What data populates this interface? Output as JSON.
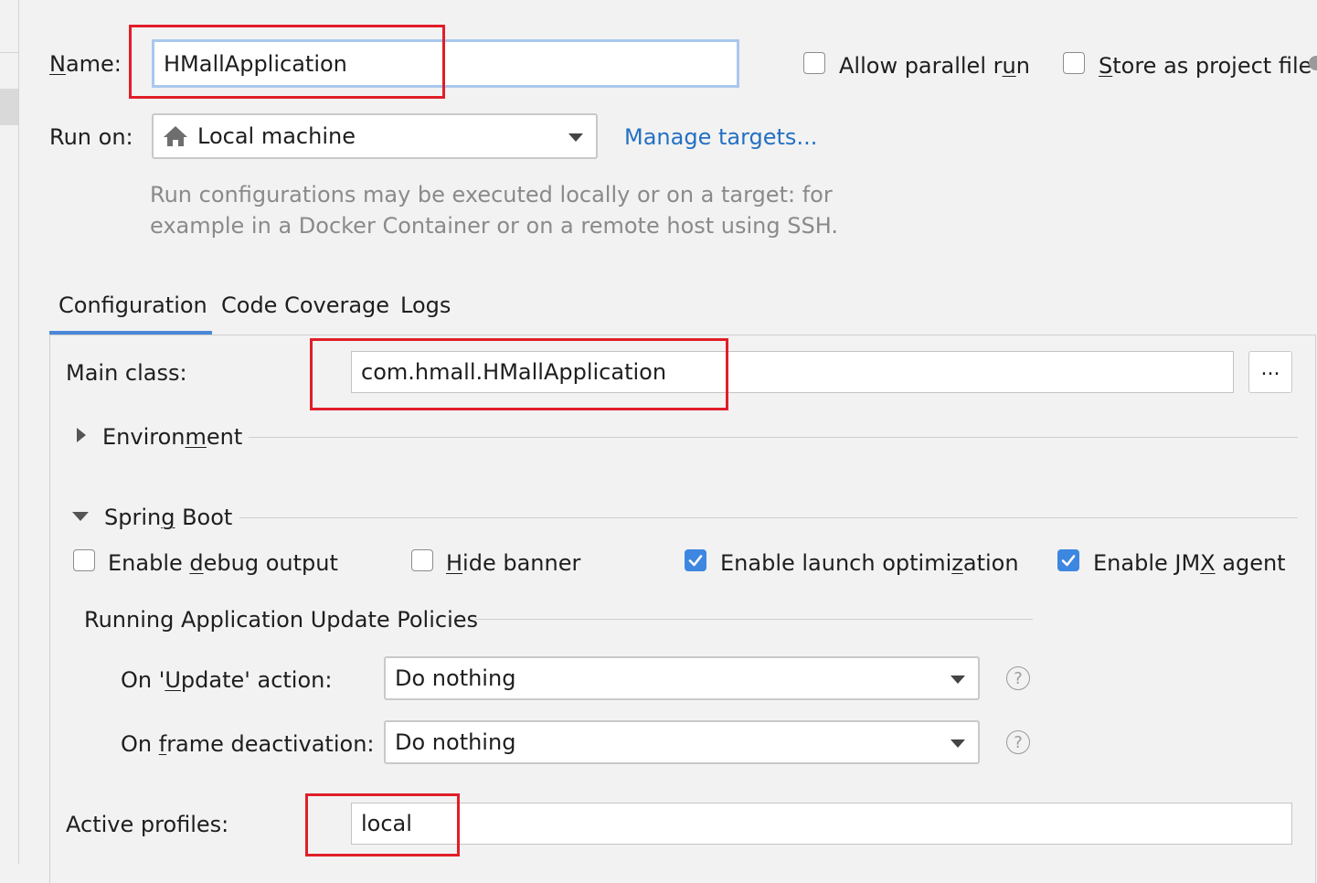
{
  "name": {
    "label_pre": "",
    "label_mnemonic": "N",
    "label_post": "ame:",
    "value": "HMallApplication"
  },
  "options": {
    "allow_parallel_pre": "Allow parallel r",
    "allow_parallel_mnemonic": "u",
    "allow_parallel_post": "n",
    "allow_parallel_checked": false,
    "store_pre": "",
    "store_mnemonic": "S",
    "store_post": "tore as project file",
    "store_checked": false
  },
  "run_on": {
    "label": "Run on:",
    "icon": "home-icon",
    "value": "Local machine",
    "manage_link": "Manage targets...",
    "hint_line1": "Run configurations may be executed locally or on a target: for",
    "hint_line2": "example in a Docker Container or on a remote host using SSH."
  },
  "tabs": [
    {
      "label": "Configuration",
      "selected": true
    },
    {
      "label": "Code Coverage",
      "selected": false
    },
    {
      "label": "Logs",
      "selected": false
    }
  ],
  "main_class": {
    "label": "Main class:",
    "value": "com.hmall.HMallApplication",
    "browse_label": "..."
  },
  "environment": {
    "label_pre": "Environ",
    "label_mnemonic": "m",
    "label_post": "ent",
    "expanded": false
  },
  "spring_boot": {
    "label_pre": "Sprin",
    "label_mnemonic": "g",
    "label_post": " Boot",
    "expanded": true,
    "debug": {
      "pre": "Enable ",
      "mnemonic": "d",
      "post": "ebug output",
      "checked": false
    },
    "hide_banner": {
      "pre": "",
      "mnemonic": "H",
      "post": "ide banner",
      "checked": false
    },
    "launch_opt": {
      "pre": "Enable launch optimi",
      "mnemonic": "z",
      "post": "ation",
      "checked": true
    },
    "jmx": {
      "pre": "Enable JM",
      "mnemonic": "X",
      "post": " agent",
      "checked": true
    }
  },
  "policies": {
    "title": "Running Application Update Policies",
    "update": {
      "pre": "On '",
      "mnemonic": "U",
      "post": "pdate' action:",
      "value": "Do nothing"
    },
    "frame": {
      "pre": "On ",
      "mnemonic": "f",
      "post": "rame deactivation:",
      "value": "Do nothing"
    },
    "help_glyph": "?"
  },
  "active_profiles": {
    "label": "Active profiles:",
    "value": "local"
  },
  "colors": {
    "accent": "#3d87e0",
    "highlight": "#e01e28",
    "link": "#2470c2",
    "tab_underline": "#4a88d9"
  }
}
